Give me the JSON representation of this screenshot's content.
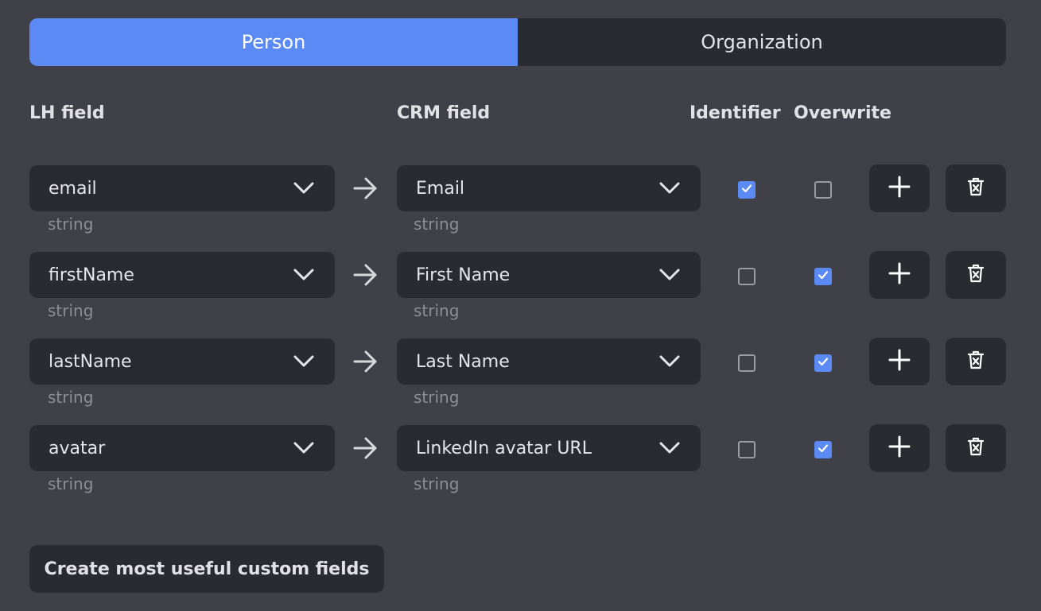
{
  "tabs": [
    {
      "label": "Person",
      "active": true
    },
    {
      "label": "Organization",
      "active": false
    }
  ],
  "headers": {
    "lh_field": "LH field",
    "crm_field": "CRM field",
    "identifier": "Identifier",
    "overwrite": "Overwrite"
  },
  "rows": [
    {
      "lh_value": "email",
      "lh_type": "string",
      "crm_value": "Email",
      "crm_type": "string",
      "identifier": true,
      "overwrite": false
    },
    {
      "lh_value": "firstName",
      "lh_type": "string",
      "crm_value": "First Name",
      "crm_type": "string",
      "identifier": false,
      "overwrite": true
    },
    {
      "lh_value": "lastName",
      "lh_type": "string",
      "crm_value": "Last Name",
      "crm_type": "string",
      "identifier": false,
      "overwrite": true
    },
    {
      "lh_value": "avatar",
      "lh_type": "string",
      "crm_value": "LinkedIn avatar URL",
      "crm_type": "string",
      "identifier": false,
      "overwrite": true
    }
  ],
  "icons": {
    "dropdown": "chevron-down-icon",
    "mapping": "arrow-right-icon",
    "add": "plus-icon",
    "delete": "trash-icon",
    "check": "check-icon"
  },
  "actions": {
    "custom_fields_label": "Create most useful custom fields"
  },
  "colors": {
    "background": "#3f4048",
    "panel": "#2a2b31",
    "accent": "#5b8af5",
    "muted_text": "#8d8e96"
  }
}
